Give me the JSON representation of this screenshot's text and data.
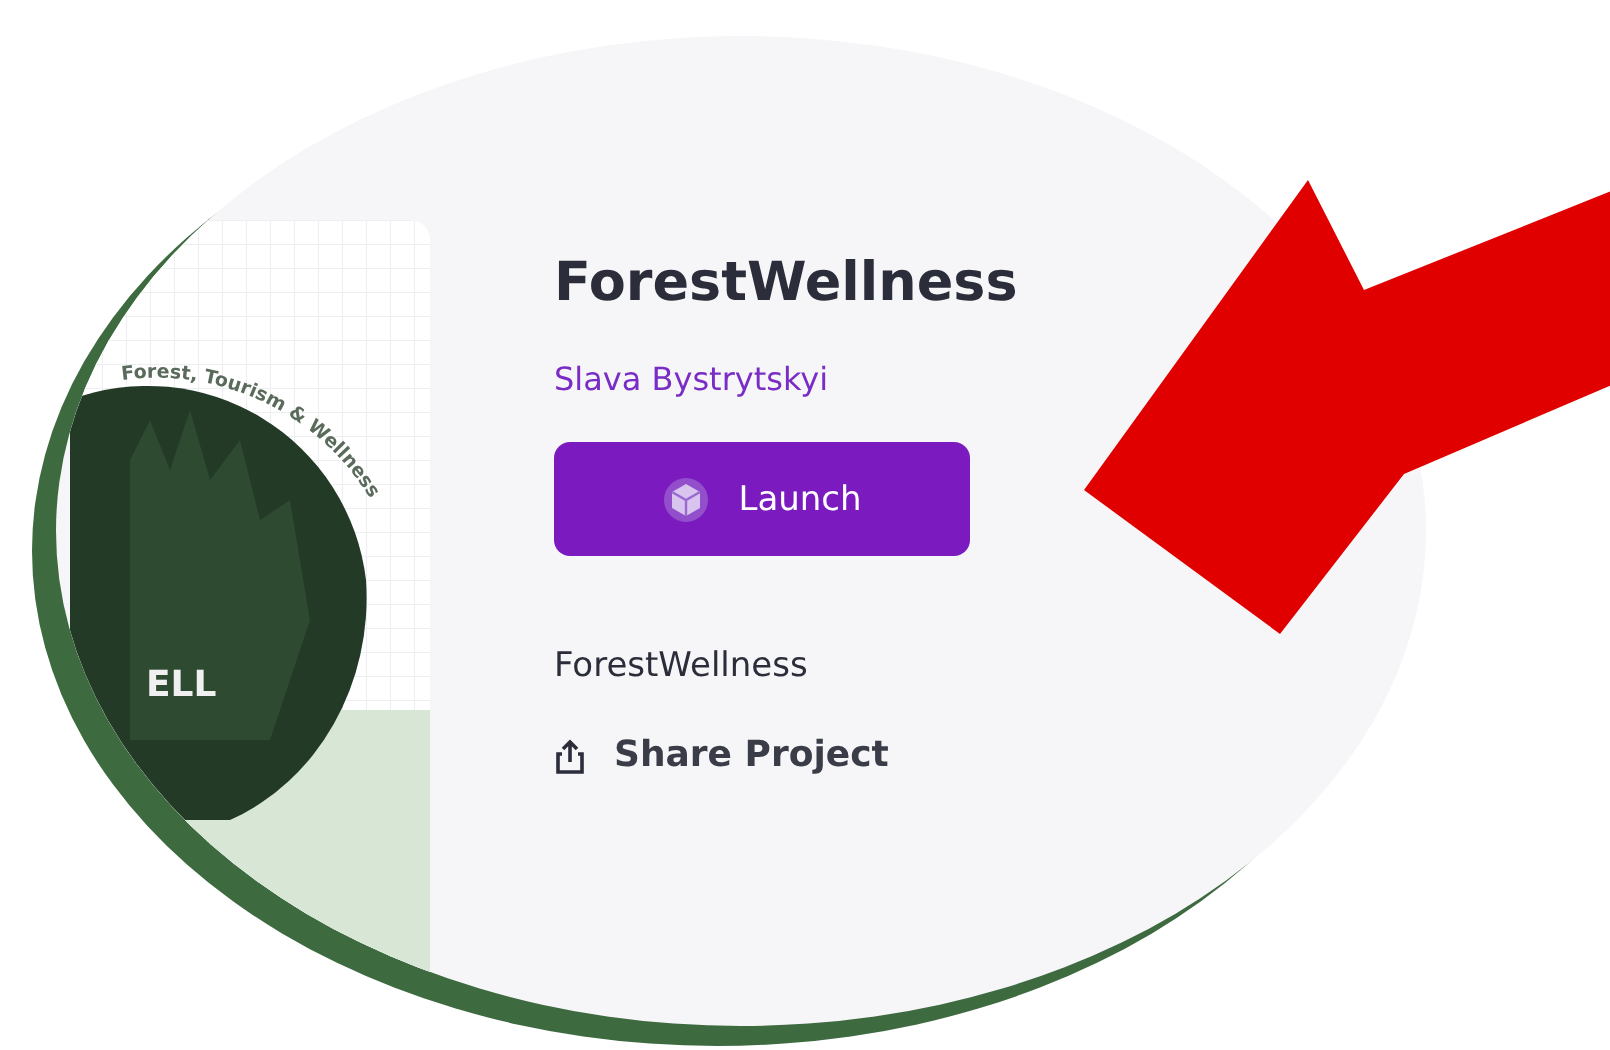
{
  "thumbnail": {
    "tagline": "Forest, Tourism & Wellness",
    "cover_word": "ELL"
  },
  "project": {
    "title": "ForestWellness",
    "author": "Slava Bystrytskyi",
    "launch_button": "Launch",
    "name": "ForestWellness",
    "share": "Share Project"
  }
}
